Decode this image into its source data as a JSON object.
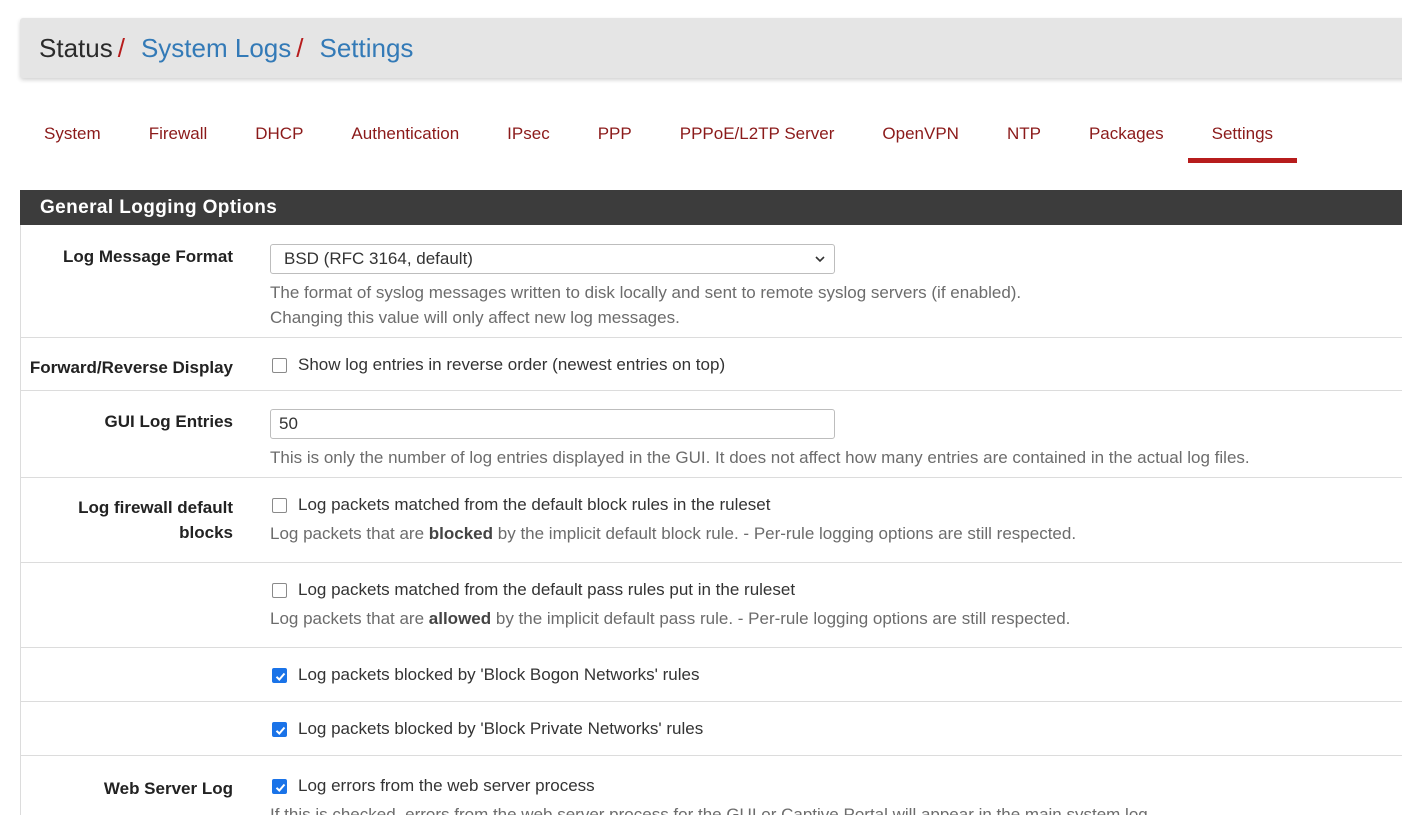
{
  "breadcrumb": {
    "root": "Status",
    "separator": "/",
    "level1": "System Logs",
    "level2": "Settings"
  },
  "tabs": [
    {
      "label": "System",
      "active": false
    },
    {
      "label": "Firewall",
      "active": false
    },
    {
      "label": "DHCP",
      "active": false
    },
    {
      "label": "Authentication",
      "active": false
    },
    {
      "label": "IPsec",
      "active": false
    },
    {
      "label": "PPP",
      "active": false
    },
    {
      "label": "PPPoE/L2TP Server",
      "active": false
    },
    {
      "label": "OpenVPN",
      "active": false
    },
    {
      "label": "NTP",
      "active": false
    },
    {
      "label": "Packages",
      "active": false
    },
    {
      "label": "Settings",
      "active": true
    }
  ],
  "panel": {
    "title": "General Logging Options",
    "log_message_format": {
      "label": "Log Message Format",
      "selected": "BSD (RFC 3164, default)",
      "help1": "The format of syslog messages written to disk locally and sent to remote syslog servers (if enabled).",
      "help2": "Changing this value will only affect new log messages."
    },
    "forward_reverse": {
      "label": "Forward/Reverse Display",
      "checkbox_label": "Show log entries in reverse order (newest entries on top)",
      "checked": false
    },
    "gui_log_entries": {
      "label": "GUI Log Entries",
      "value": "50",
      "help": "This is only the number of log entries displayed in the GUI. It does not affect how many entries are contained in the actual log files."
    },
    "fw_default_blocks": {
      "label_line1": "Log firewall default",
      "label_line2": "blocks",
      "checkbox_label": "Log packets matched from the default block rules in the ruleset",
      "checked": false,
      "help_pre": "Log packets that are",
      "help_bold": "blocked",
      "help_post": "by the implicit default block rule. - Per-rule logging options are still respected."
    },
    "fw_default_pass": {
      "checkbox_label": "Log packets matched from the default pass rules put in the ruleset",
      "checked": false,
      "help_pre": "Log packets that are",
      "help_bold": "allowed",
      "help_post": "by the implicit default pass rule. - Per-rule logging options are still respected."
    },
    "bogon": {
      "checkbox_label": "Log packets blocked by 'Block Bogon Networks' rules",
      "checked": true
    },
    "private": {
      "checkbox_label": "Log packets blocked by 'Block Private Networks' rules",
      "checked": true
    },
    "web_server_log": {
      "label": "Web Server Log",
      "checkbox_label": "Log errors from the web server process",
      "checked": true,
      "help": "If this is checked, errors from the web server process for the GUI or Captive Portal will appear in the main system log."
    }
  },
  "colors": {
    "accent": "#b71c1c",
    "link": "#337ab7",
    "panel_heading": "#3c3c3c",
    "checkbox_checked": "#1a73e8"
  }
}
